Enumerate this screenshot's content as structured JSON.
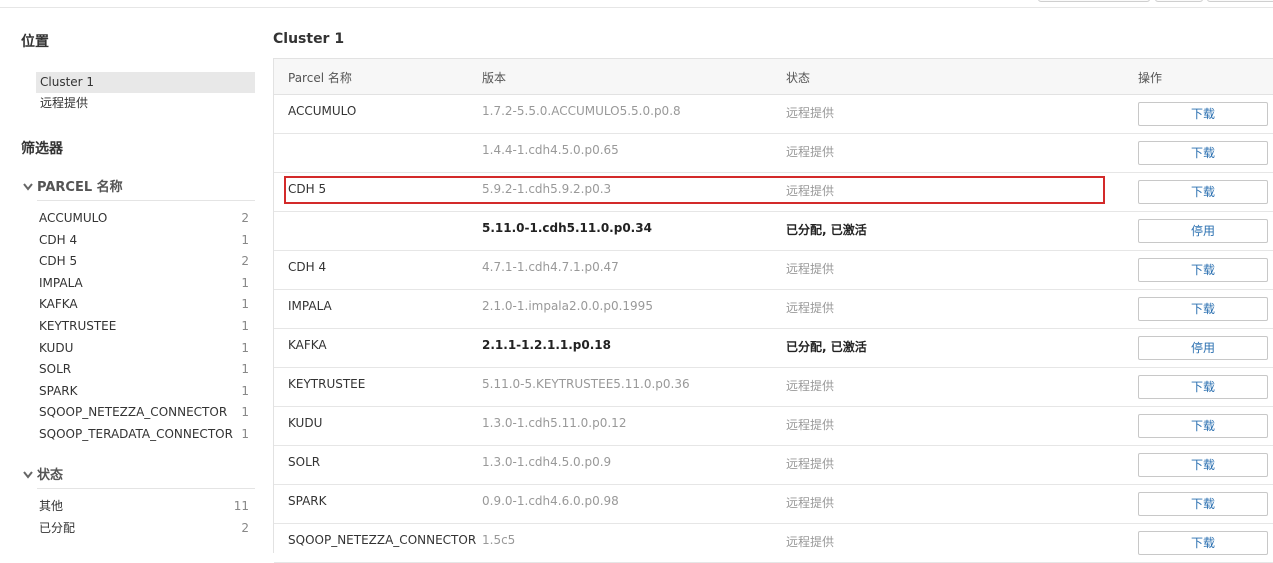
{
  "sidebar": {
    "location_title": "位置",
    "locations": [
      {
        "label": "Cluster 1",
        "active": true
      },
      {
        "label": "远程提供",
        "active": false
      }
    ],
    "filter_title": "筛选器",
    "parcel_group": {
      "title": "PARCEL 名称",
      "items": [
        {
          "label": "ACCUMULO",
          "count": "2"
        },
        {
          "label": "CDH 4",
          "count": "1"
        },
        {
          "label": "CDH 5",
          "count": "2"
        },
        {
          "label": "IMPALA",
          "count": "1"
        },
        {
          "label": "KAFKA",
          "count": "1"
        },
        {
          "label": "KEYTRUSTEE",
          "count": "1"
        },
        {
          "label": "KUDU",
          "count": "1"
        },
        {
          "label": "SOLR",
          "count": "1"
        },
        {
          "label": "SPARK",
          "count": "1"
        },
        {
          "label": "SQOOP_NETEZZA_CONNECTOR",
          "count": "1"
        },
        {
          "label": "SQOOP_TERADATA_CONNECTOR",
          "count": "1"
        }
      ]
    },
    "status_group": {
      "title": "状态",
      "items": [
        {
          "label": "其他",
          "count": "11"
        },
        {
          "label": "已分配",
          "count": "2"
        }
      ]
    }
  },
  "main": {
    "title": "Cluster 1",
    "columns": {
      "name": "Parcel 名称",
      "version": "版本",
      "status": "状态",
      "action": "操作"
    },
    "rows": [
      {
        "name": "ACCUMULO",
        "version": "1.7.2-5.5.0.ACCUMULO5.5.0.p0.8",
        "status": "远程提供",
        "action": "下载",
        "activated": false
      },
      {
        "name": "",
        "version": "1.4.4-1.cdh4.5.0.p0.65",
        "status": "远程提供",
        "action": "下载",
        "activated": false
      },
      {
        "name": "CDH 5",
        "version": "5.9.2-1.cdh5.9.2.p0.3",
        "status": "远程提供",
        "action": "下载",
        "activated": false,
        "highlighted": true
      },
      {
        "name": "",
        "version": "5.11.0-1.cdh5.11.0.p0.34",
        "status": "已分配, 已激活",
        "action": "停用",
        "activated": true
      },
      {
        "name": "CDH 4",
        "version": "4.7.1-1.cdh4.7.1.p0.47",
        "status": "远程提供",
        "action": "下载",
        "activated": false
      },
      {
        "name": "IMPALA",
        "version": "2.1.0-1.impala2.0.0.p0.1995",
        "status": "远程提供",
        "action": "下载",
        "activated": false
      },
      {
        "name": "KAFKA",
        "version": "2.1.1-1.2.1.1.p0.18",
        "status": "已分配, 已激活",
        "action": "停用",
        "activated": true
      },
      {
        "name": "KEYTRUSTEE",
        "version": "5.11.0-5.KEYTRUSTEE5.11.0.p0.36",
        "status": "远程提供",
        "action": "下载",
        "activated": false
      },
      {
        "name": "KUDU",
        "version": "1.3.0-1.cdh5.11.0.p0.12",
        "status": "远程提供",
        "action": "下载",
        "activated": false
      },
      {
        "name": "SOLR",
        "version": "1.3.0-1.cdh4.5.0.p0.9",
        "status": "远程提供",
        "action": "下载",
        "activated": false
      },
      {
        "name": "SPARK",
        "version": "0.9.0-1.cdh4.6.0.p0.98",
        "status": "远程提供",
        "action": "下载",
        "activated": false
      },
      {
        "name": "SQOOP_NETEZZA_CONNECTOR",
        "version": "1.5c5",
        "status": "远程提供",
        "action": "下载",
        "activated": false
      }
    ]
  },
  "colors": {
    "highlight": "#d32a2a",
    "link": "#2a6fb0"
  },
  "icons": {
    "group_toggle": "chevron-down-icon"
  }
}
